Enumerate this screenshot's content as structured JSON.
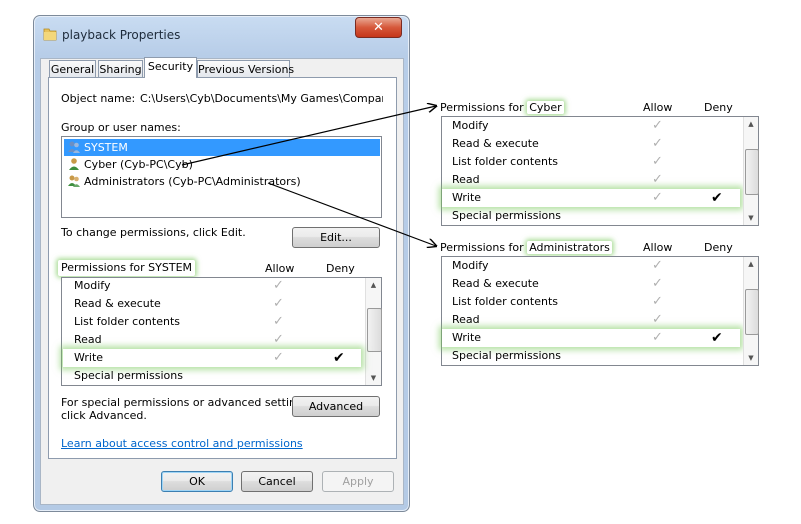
{
  "dialog": {
    "title": "playback Properties",
    "close_glyph": "✕",
    "tabs": [
      {
        "label": "General"
      },
      {
        "label": "Sharing"
      },
      {
        "label": "Security"
      },
      {
        "label": "Previous Versions"
      }
    ],
    "active_tab": "Security",
    "object_name_label": "Object name:",
    "object_name_value": "C:\\Users\\Cyb\\Documents\\My Games\\Company of",
    "group_label": "Group or user names:",
    "users": [
      {
        "name": "SYSTEM",
        "selected": true,
        "icon": "users-group-icon"
      },
      {
        "name": "Cyber (Cyb-PC\\Cyb)",
        "selected": false,
        "icon": "user-icon"
      },
      {
        "name": "Administrators (Cyb-PC\\Administrators)",
        "selected": false,
        "icon": "users-group-icon"
      }
    ],
    "change_text": "To change permissions, click Edit.",
    "edit_button": "Edit...",
    "permissions_title": "Permissions for SYSTEM",
    "allow_header": "Allow",
    "deny_header": "Deny",
    "permissions": [
      {
        "name": "Modify",
        "allow": true,
        "deny": false
      },
      {
        "name": "Read & execute",
        "allow": true,
        "deny": false
      },
      {
        "name": "List folder contents",
        "allow": true,
        "deny": false
      },
      {
        "name": "Read",
        "allow": true,
        "deny": false
      },
      {
        "name": "Write",
        "allow": true,
        "deny": true
      },
      {
        "name": "Special permissions",
        "allow": false,
        "deny": false
      }
    ],
    "advanced_text_1": "For special permissions or advanced settings,",
    "advanced_text_2": "click Advanced.",
    "advanced_button": "Advanced",
    "learn_link": "Learn about access control and permissions",
    "ok_button": "OK",
    "cancel_button": "Cancel",
    "apply_button": "Apply"
  },
  "callouts": [
    {
      "prefix": "Permissions for ",
      "subject": "Cyber",
      "allow_header": "Allow",
      "deny_header": "Deny",
      "permissions": [
        {
          "name": "Modify",
          "allow": true,
          "deny": false
        },
        {
          "name": "Read & execute",
          "allow": true,
          "deny": false
        },
        {
          "name": "List folder contents",
          "allow": true,
          "deny": false
        },
        {
          "name": "Read",
          "allow": true,
          "deny": false
        },
        {
          "name": "Write",
          "allow": true,
          "deny": true
        },
        {
          "name": "Special permissions",
          "allow": false,
          "deny": false
        }
      ]
    },
    {
      "prefix": "Permissions for ",
      "subject": "Administrators",
      "allow_header": "Allow",
      "deny_header": "Deny",
      "permissions": [
        {
          "name": "Modify",
          "allow": true,
          "deny": false
        },
        {
          "name": "Read & execute",
          "allow": true,
          "deny": false
        },
        {
          "name": "List folder contents",
          "allow": true,
          "deny": false
        },
        {
          "name": "Read",
          "allow": true,
          "deny": false
        },
        {
          "name": "Write",
          "allow": true,
          "deny": true
        },
        {
          "name": "Special permissions",
          "allow": false,
          "deny": false
        }
      ]
    }
  ],
  "glyphs": {
    "check": "✓",
    "check_bold": "✔",
    "scroll_up": "▲",
    "scroll_down": "▼",
    "grip": "≡"
  },
  "colors": {
    "selection": "#3399ff",
    "highlight_glow": "#78c85a",
    "link": "#0066cc",
    "close_red": "#c5361a"
  }
}
